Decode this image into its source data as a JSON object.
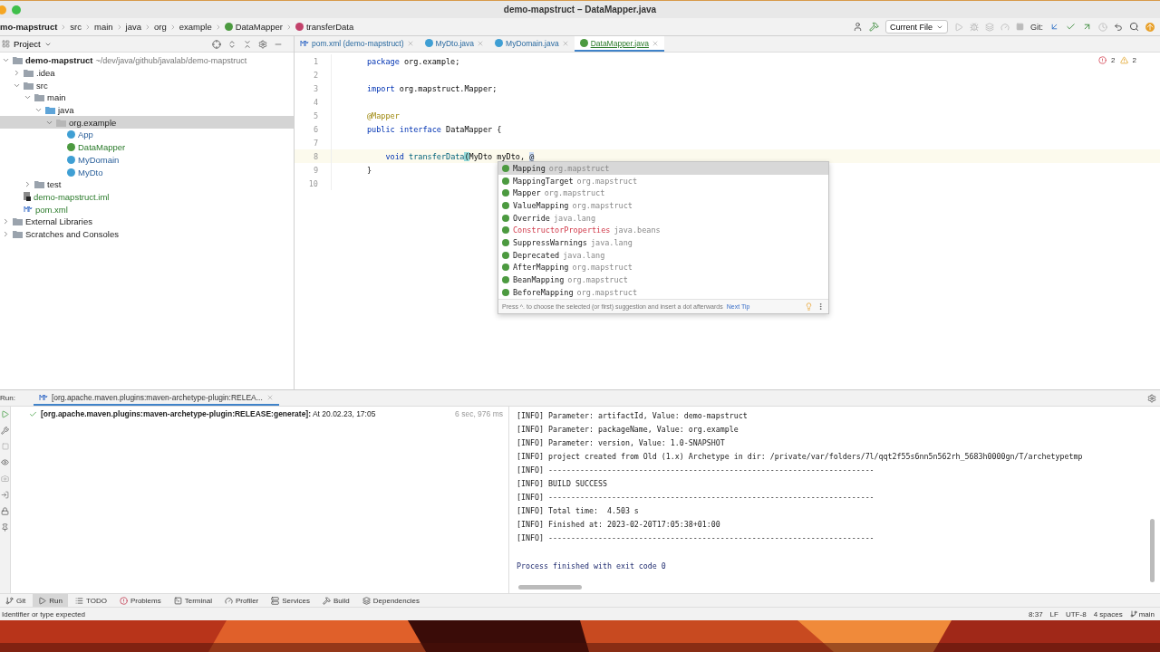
{
  "window": {
    "title": "demo-mapstruct – DataMapper.java"
  },
  "breadcrumbs": [
    {
      "label": "mo-mapstruct",
      "kind": "project"
    },
    {
      "label": "src",
      "kind": "folder"
    },
    {
      "label": "main",
      "kind": "folder"
    },
    {
      "label": "java",
      "kind": "folder"
    },
    {
      "label": "org",
      "kind": "folder"
    },
    {
      "label": "example",
      "kind": "folder"
    },
    {
      "label": "DataMapper",
      "kind": "interface"
    },
    {
      "label": "transferData",
      "kind": "method"
    }
  ],
  "toolbar": {
    "run_config": "Current File",
    "git_label": "Git:"
  },
  "project_panel": {
    "title": "Project",
    "tree": [
      {
        "name": "demo-mapstruct",
        "hint": "~/dev/java/github/javalab/demo-mapstruct",
        "kind": "project",
        "expanded": true,
        "selected": false,
        "children": [
          {
            "name": ".idea",
            "kind": "folder",
            "expanded": false,
            "selected": false
          },
          {
            "name": "src",
            "kind": "folder",
            "expanded": true,
            "selected": false,
            "children": [
              {
                "name": "main",
                "kind": "folder",
                "expanded": true,
                "selected": false,
                "children": [
                  {
                    "name": "java",
                    "kind": "source",
                    "expanded": true,
                    "selected": false,
                    "children": [
                      {
                        "name": "org.example",
                        "kind": "package",
                        "expanded": true,
                        "selected": true,
                        "children": [
                          {
                            "name": "App",
                            "kind": "class",
                            "selected": false
                          },
                          {
                            "name": "DataMapper",
                            "kind": "interface",
                            "selected": false
                          },
                          {
                            "name": "MyDomain",
                            "kind": "class",
                            "selected": false
                          },
                          {
                            "name": "MyDto",
                            "kind": "class",
                            "selected": false
                          }
                        ]
                      }
                    ]
                  }
                ]
              },
              {
                "name": "test",
                "kind": "folder",
                "expanded": false,
                "selected": false
              }
            ]
          },
          {
            "name": "demo-mapstruct.iml",
            "kind": "iml",
            "selected": false
          },
          {
            "name": "pom.xml",
            "kind": "maven",
            "selected": false
          }
        ]
      },
      {
        "name": "External Libraries",
        "kind": "libraries",
        "expanded": false,
        "selected": false
      },
      {
        "name": "Scratches and Consoles",
        "kind": "scratches",
        "expanded": false,
        "selected": false
      }
    ]
  },
  "editor": {
    "tabs": [
      {
        "label": "pom.xml (demo-mapstruct)",
        "kind": "maven",
        "selected": false
      },
      {
        "label": "MyDto.java",
        "kind": "class",
        "selected": false
      },
      {
        "label": "MyDomain.java",
        "kind": "class",
        "selected": false
      },
      {
        "label": "DataMapper.java",
        "kind": "interface",
        "selected": true
      }
    ],
    "errors": "2",
    "warnings": "2",
    "lines": [
      {
        "number": "1",
        "tokens": [
          {
            "text": "package",
            "kind": "keyword"
          },
          {
            "text": " org.example;",
            "kind": "plain"
          }
        ]
      },
      {
        "number": "2"
      },
      {
        "number": "3",
        "tokens": [
          {
            "text": "import",
            "kind": "keyword"
          },
          {
            "text": " org.mapstruct.Mapper;",
            "kind": "plain"
          }
        ]
      },
      {
        "number": "4"
      },
      {
        "number": "5",
        "tokens": [
          {
            "text": "@Mapper",
            "kind": "annotation"
          }
        ]
      },
      {
        "number": "6",
        "tokens": [
          {
            "text": "public interface",
            "kind": "keyword"
          },
          {
            "text": " DataMapper {",
            "kind": "plain"
          }
        ]
      },
      {
        "number": "7"
      },
      {
        "number": "8",
        "current": true,
        "tokens": [
          {
            "text": "    void",
            "kind": "keyword"
          },
          {
            "text": " transferData",
            "kind": "method"
          },
          {
            "text": "(",
            "kind": "brace"
          },
          {
            "text": "MyDto myDto, ",
            "kind": "plain"
          },
          {
            "text": "@",
            "kind": "error"
          }
        ]
      },
      {
        "number": "9",
        "tokens": [
          {
            "text": "}",
            "kind": "plain"
          }
        ]
      },
      {
        "number": "10"
      }
    ],
    "completion": {
      "items": [
        {
          "name": "Mapping",
          "package": "org.mapstruct",
          "selected": true,
          "unavailable": false
        },
        {
          "name": "MappingTarget",
          "package": "org.mapstruct",
          "selected": false,
          "unavailable": false
        },
        {
          "name": "Mapper",
          "package": "org.mapstruct",
          "selected": false,
          "unavailable": false
        },
        {
          "name": "ValueMapping",
          "package": "org.mapstruct",
          "selected": false,
          "unavailable": false
        },
        {
          "name": "Override",
          "package": "java.lang",
          "selected": false,
          "unavailable": false
        },
        {
          "name": "ConstructorProperties",
          "package": "java.beans",
          "selected": false,
          "unavailable": true
        },
        {
          "name": "SuppressWarnings",
          "package": "java.lang",
          "selected": false,
          "unavailable": false
        },
        {
          "name": "Deprecated",
          "package": "java.lang",
          "selected": false,
          "unavailable": false
        },
        {
          "name": "AfterMapping",
          "package": "org.mapstruct",
          "selected": false,
          "unavailable": false
        },
        {
          "name": "BeanMapping",
          "package": "org.mapstruct",
          "selected": false,
          "unavailable": false
        },
        {
          "name": "BeforeMapping",
          "package": "org.mapstruct",
          "selected": false,
          "unavailable": false
        }
      ],
      "hint": "Press ^. to choose the selected (or first) suggestion and insert a dot afterwards",
      "next_tip": "Next Tip"
    }
  },
  "run_panel": {
    "label": "Run:",
    "tab": "[org.apache.maven.plugins:maven-archetype-plugin:RELEA...",
    "task": {
      "title": "**[org.apache.maven.plugins:maven-archetype-plugin:RELEASE:generate]:** At 20.02.23, 17:05",
      "duration": "6 sec, 976 ms"
    },
    "console": [
      "[INFO] Parameter: artifactId, Value: demo-mapstruct",
      "[INFO] Parameter: packageName, Value: org.example",
      "[INFO] Parameter: version, Value: 1.0-SNAPSHOT",
      "[INFO] project created from Old (1.x) Archetype in dir: /private/var/folders/7l/qqt2f55s6nn5n562rh_5683h0000gn/T/archetypetmp",
      "[INFO] ------------------------------------------------------------------------",
      "[INFO] BUILD SUCCESS",
      "[INFO] ------------------------------------------------------------------------",
      "[INFO] Total time:  4.503 s",
      "[INFO] Finished at: 2023-02-20T17:05:38+01:00",
      "[INFO] ------------------------------------------------------------------------"
    ],
    "exit_message": "Process finished with exit code 0"
  },
  "tool_windows": [
    {
      "label": "Git",
      "kind": "git",
      "selected": false
    },
    {
      "label": "Run",
      "kind": "run",
      "selected": true
    },
    {
      "label": "TODO",
      "kind": "todo",
      "selected": false
    },
    {
      "label": "Problems",
      "kind": "problems",
      "selected": false
    },
    {
      "label": "Terminal",
      "kind": "terminal",
      "selected": false
    },
    {
      "label": "Profiler",
      "kind": "profiler",
      "selected": false
    },
    {
      "label": "Services",
      "kind": "services",
      "selected": false
    },
    {
      "label": "Build",
      "kind": "build",
      "selected": false
    },
    {
      "label": "Dependencies",
      "kind": "dependencies",
      "selected": false
    }
  ],
  "status_bar": {
    "message": "Identifier or type expected",
    "position": "8:37",
    "line_ending": "LF",
    "encoding": "UTF-8",
    "indent": "4 spaces",
    "branch": "main"
  }
}
